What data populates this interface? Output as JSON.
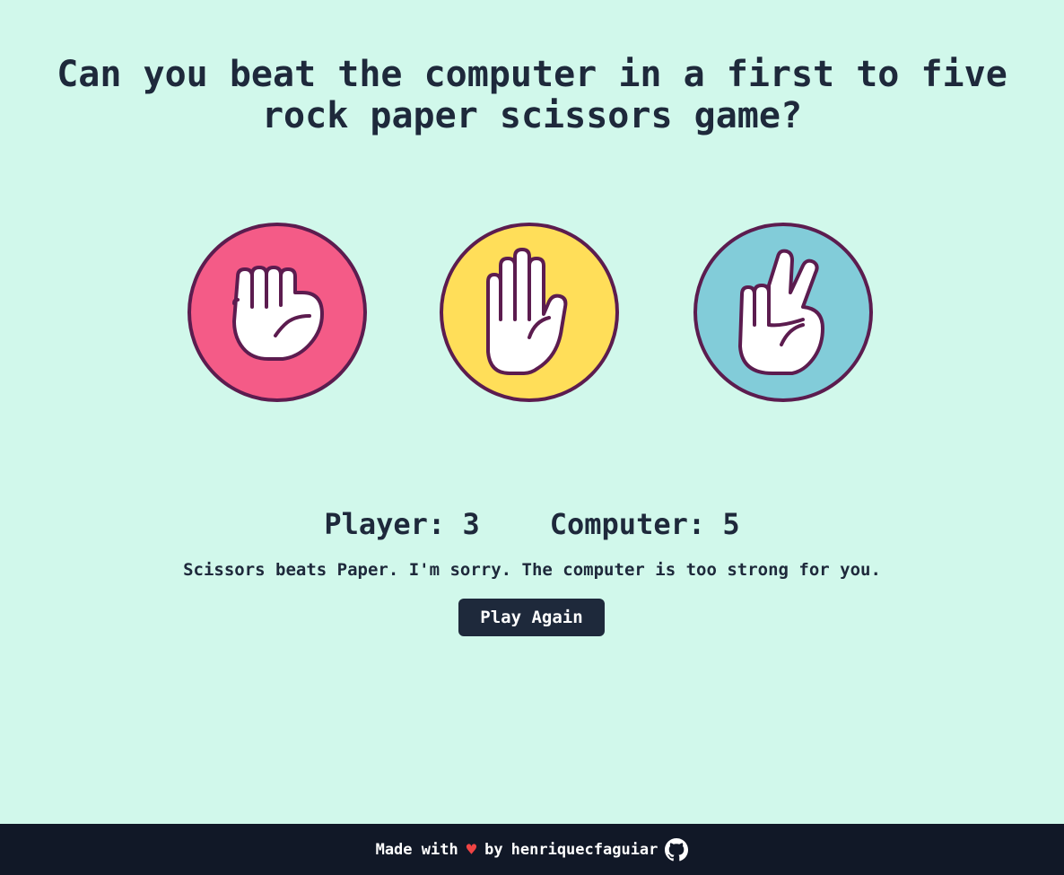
{
  "heading": {
    "line1": "Can you beat the computer in a first to five",
    "line2": "rock paper scissors game?"
  },
  "choices": [
    {
      "name": "rock",
      "icon": "fist-hand-icon",
      "color": "#f45b87"
    },
    {
      "name": "paper",
      "icon": "open-hand-icon",
      "color": "#ffde59"
    },
    {
      "name": "scissors",
      "icon": "peace-hand-icon",
      "color": "#82ccd9"
    }
  ],
  "colors": {
    "background": "#d1f8eb",
    "text": "#1e293b",
    "outline": "#5c1c4f",
    "button": "#1e293b",
    "footer": "#111827",
    "heart": "#ef4444"
  },
  "score": {
    "player_label": "Player: 3",
    "computer_label": "Computer: 5"
  },
  "message": "Scissors beats Paper. I'm sorry. The computer is too strong for you.",
  "play_again_label": "Play Again",
  "footer": {
    "made_with": "Made with",
    "heart": "♥",
    "by": "by",
    "author": "henriquecfaguiar",
    "github_icon": "github-icon"
  }
}
